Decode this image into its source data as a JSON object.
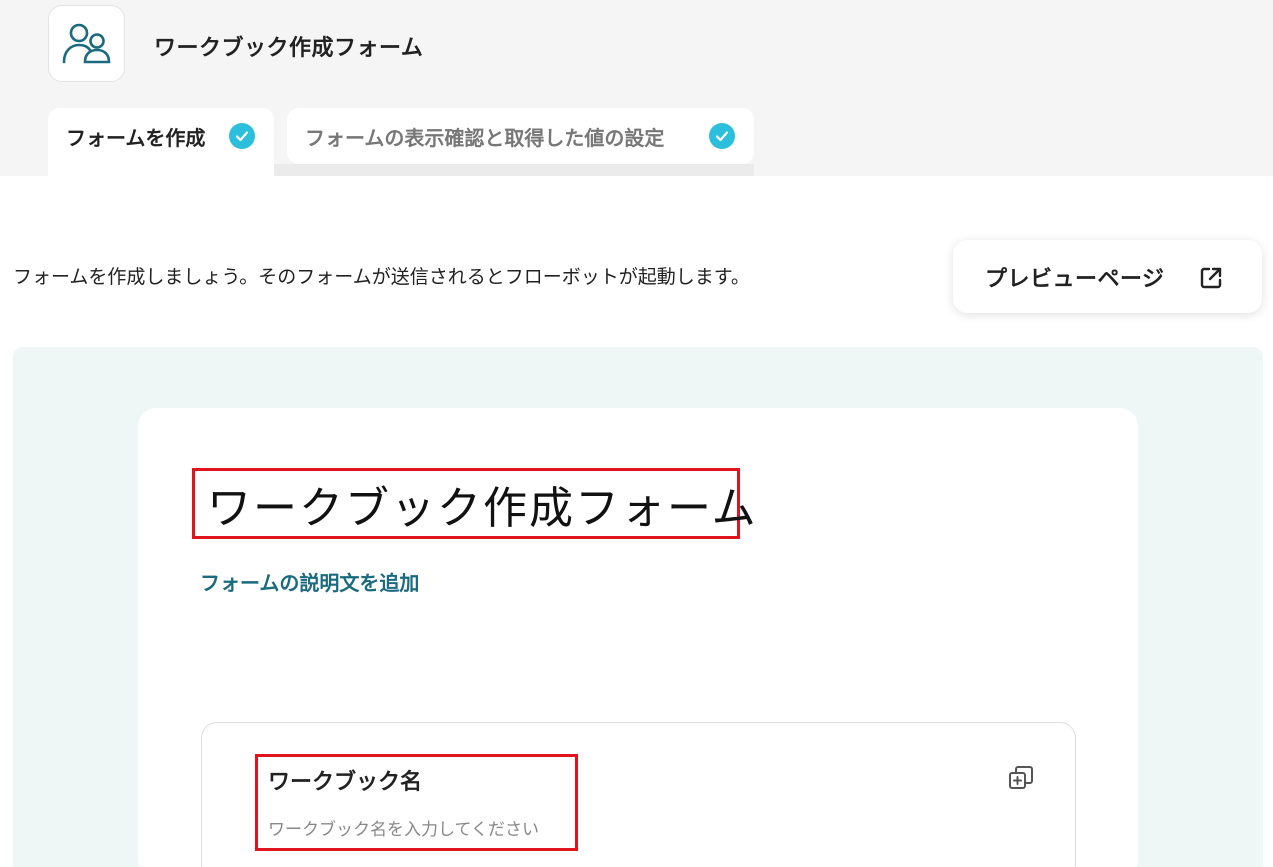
{
  "header": {
    "app_icon": "users-icon",
    "title": "ワークブック作成フォーム"
  },
  "tabs": [
    {
      "label": "フォームを作成",
      "icon": "check-circle-icon",
      "active": true
    },
    {
      "label": "フォームの表示確認と取得した値の設定",
      "icon": "check-circle-icon",
      "active": false
    }
  ],
  "intro": {
    "text": "フォームを作成しましょう。そのフォームが送信されるとフローボットが起動します。"
  },
  "preview_button": {
    "label": "プレビューページ",
    "icon": "external-link-icon"
  },
  "form": {
    "title": "ワークブック作成フォーム",
    "add_description_link": "フォームの説明文を追加",
    "fields": [
      {
        "label": "ワークブック名",
        "placeholder": "ワークブック名を入力してください",
        "action_icon": "duplicate-icon"
      }
    ]
  },
  "colors": {
    "accent_teal": "#1a6a80",
    "check_blue": "#2bbfdb",
    "highlight_red": "#e0141d",
    "canvas_bg": "#eef7f6"
  }
}
